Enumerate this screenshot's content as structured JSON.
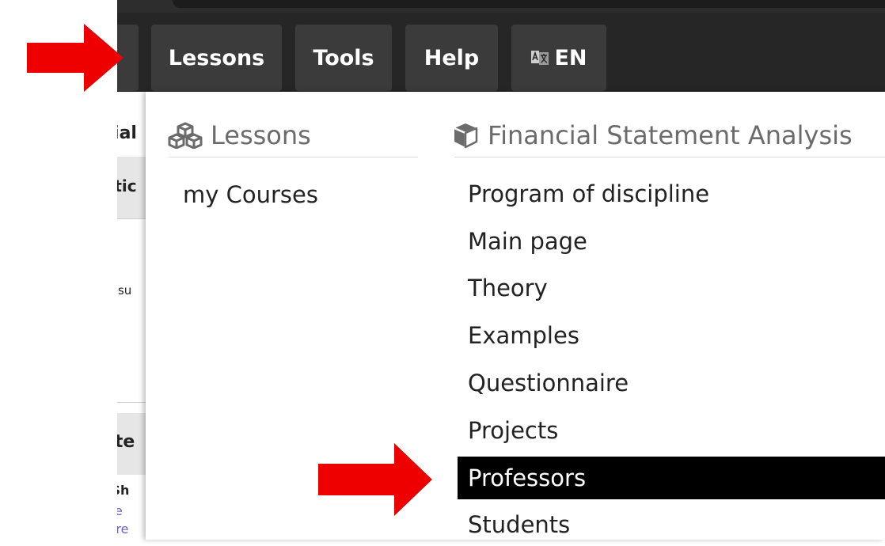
{
  "navbar": {
    "items": [
      {
        "label": "Lessons"
      },
      {
        "label": "Tools"
      },
      {
        "label": "Help"
      },
      {
        "label": "EN"
      }
    ]
  },
  "background_page": {
    "fragments": [
      "cial",
      "ptic",
      "Resu",
      "ate",
      "' Sh",
      "rse",
      "ture"
    ]
  },
  "dropdown": {
    "lessons_column": {
      "heading": "Lessons",
      "items": [
        {
          "label": "my Courses"
        }
      ]
    },
    "course_column": {
      "heading": "Financial Statement Analysis",
      "items": [
        {
          "label": "Program of discipline"
        },
        {
          "label": "Main page"
        },
        {
          "label": "Theory"
        },
        {
          "label": "Examples"
        },
        {
          "label": "Questionnaire"
        },
        {
          "label": "Projects"
        },
        {
          "label": "Professors",
          "active": true
        },
        {
          "label": "Students"
        }
      ]
    }
  },
  "colors": {
    "navbar_bg": "#262626",
    "nav_button_bg": "#3b3b3b",
    "active_item_bg": "#000000",
    "annotation_arrow": "#ee0000"
  },
  "icons": {
    "lessons_heading": "cubes-icon",
    "course_heading": "cube-icon",
    "language": "translate-icon"
  }
}
